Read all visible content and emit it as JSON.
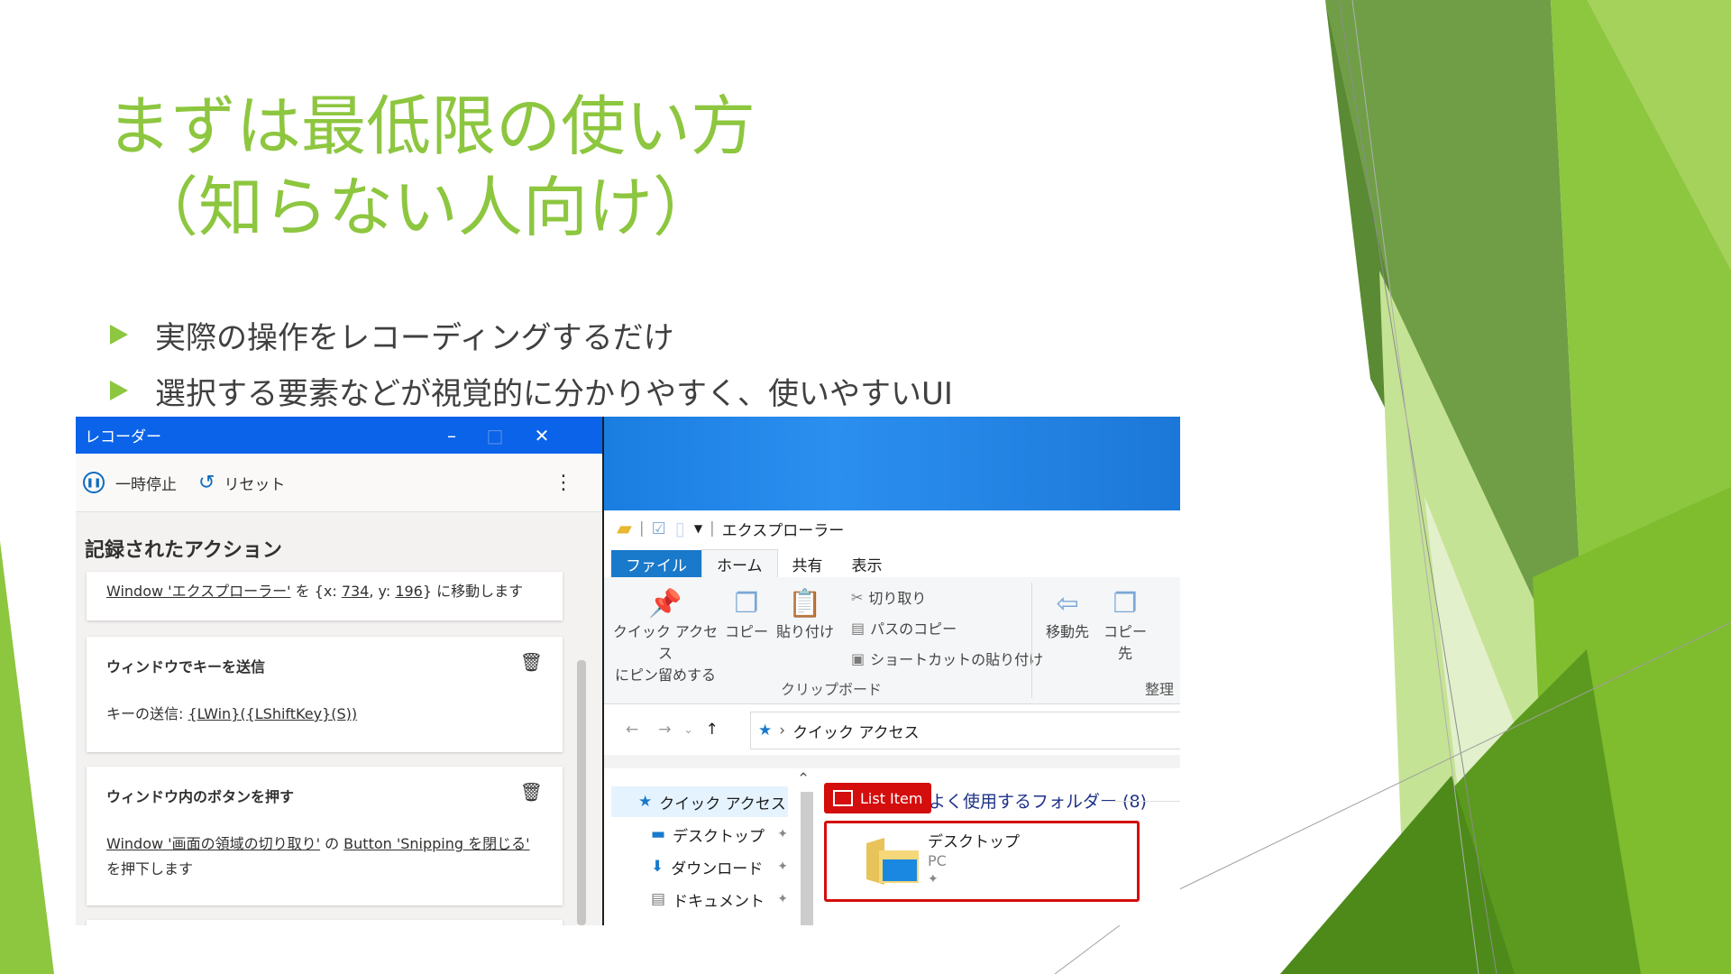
{
  "slide": {
    "title_line1": "まずは最低限の使い方",
    "title_line2": "（知らない人向け）",
    "bullets": [
      "実際の操作をレコーディングするだけ",
      "選択する要素などが視覚的に分かりやすく、使いやすいUI"
    ],
    "accent_color": "#8dc63f"
  },
  "recorder": {
    "title": "レコーダー",
    "minimize": "–",
    "maximize": "□",
    "close": "✕",
    "pause_label": "一時停止",
    "reset_label": "リセット",
    "more": "⋮",
    "section_title": "記録されたアクション",
    "action0": {
      "window_link": "Window 'エクスプローラー'",
      "mid": " を {x: ",
      "x": "734",
      "sep": ", y: ",
      "y": "196",
      "tail": "} に移動します"
    },
    "action1": {
      "title": "ウィンドウでキーを送信",
      "label": "キーの送信: ",
      "keys": "{LWin}({LShiftKey}(S))"
    },
    "action2": {
      "title": "ウィンドウ内のボタンを押す",
      "window_link": "Window '画面の領域の切り取り'",
      "mid": " の ",
      "button_link": "Button 'Snipping を閉じる'",
      "tail": "を押下します"
    },
    "delete_icon": "🗑"
  },
  "explorer": {
    "window_title": "エクスプローラー",
    "tabs": [
      "ファイル",
      "ホーム",
      "共有",
      "表示"
    ],
    "ribbon": {
      "pin_line1": "クイック アクセス",
      "pin_line2": "にピン留めする",
      "copy": "コピー",
      "paste": "貼り付け",
      "cut": "切り取り",
      "copy_path": "パスのコピー",
      "paste_shortcut": "ショートカットの貼り付け",
      "move_to": "移動先",
      "copy_to": "コピー先",
      "group_clipboard": "クリップボード",
      "group_organize": "整理"
    },
    "address": "クイック アクセス",
    "nav": {
      "quick_access": "クイック アクセス",
      "desktop": "デスクトップ",
      "downloads": "ダウンロード",
      "documents": "ドキュメント"
    },
    "badge": "List Item",
    "group_title": "よく使用するフォルダー (8)",
    "item_name": "デスクトップ",
    "item_sub": "PC"
  }
}
